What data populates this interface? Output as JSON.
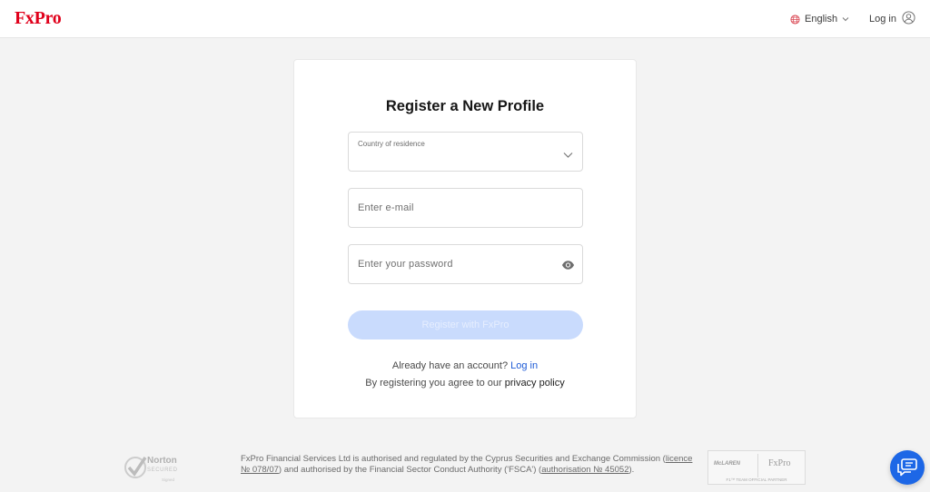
{
  "header": {
    "logo": "FxPro",
    "language": "English",
    "login": "Log in"
  },
  "form": {
    "title": "Register a New Profile",
    "country_label": "Country of residence",
    "email_placeholder": "Enter e-mail",
    "password_placeholder": "Enter your password",
    "register_button": "Register with FxPro",
    "have_account": "Already have an account?",
    "login_link": "Log in",
    "agree_text": "By registering you agree to our",
    "privacy_link": "privacy policy"
  },
  "footer": {
    "norton_title": "Norton",
    "norton_secured": "SECURED",
    "norton_sub": "Signed",
    "text_part1": "FxPro Financial Services Ltd is authorised and regulated by the Cyprus Securities and Exchange Commission (",
    "licence_link": "licence № 078/07",
    "text_part2": ") and authorised by the Financial Sector Conduct Authority ('FSCA') (",
    "authorisation_link": "authorisation № 45052",
    "text_part3": ").",
    "sponsor_left": "McLAREN",
    "sponsor_right": "FxPro",
    "sponsor_tag": "F1™ TEAM OFFICIAL PARTNER"
  },
  "colors": {
    "brand_red": "#e0001b",
    "link_blue": "#1e5bd6",
    "button_disabled": "#c9dbfd",
    "chat_blue": "#1d67e6"
  },
  "icons": {
    "language": "globe-icon",
    "login": "user-circle-icon",
    "select": "chevron-down-icon",
    "password": "eye-icon",
    "chat": "chat-icon"
  }
}
